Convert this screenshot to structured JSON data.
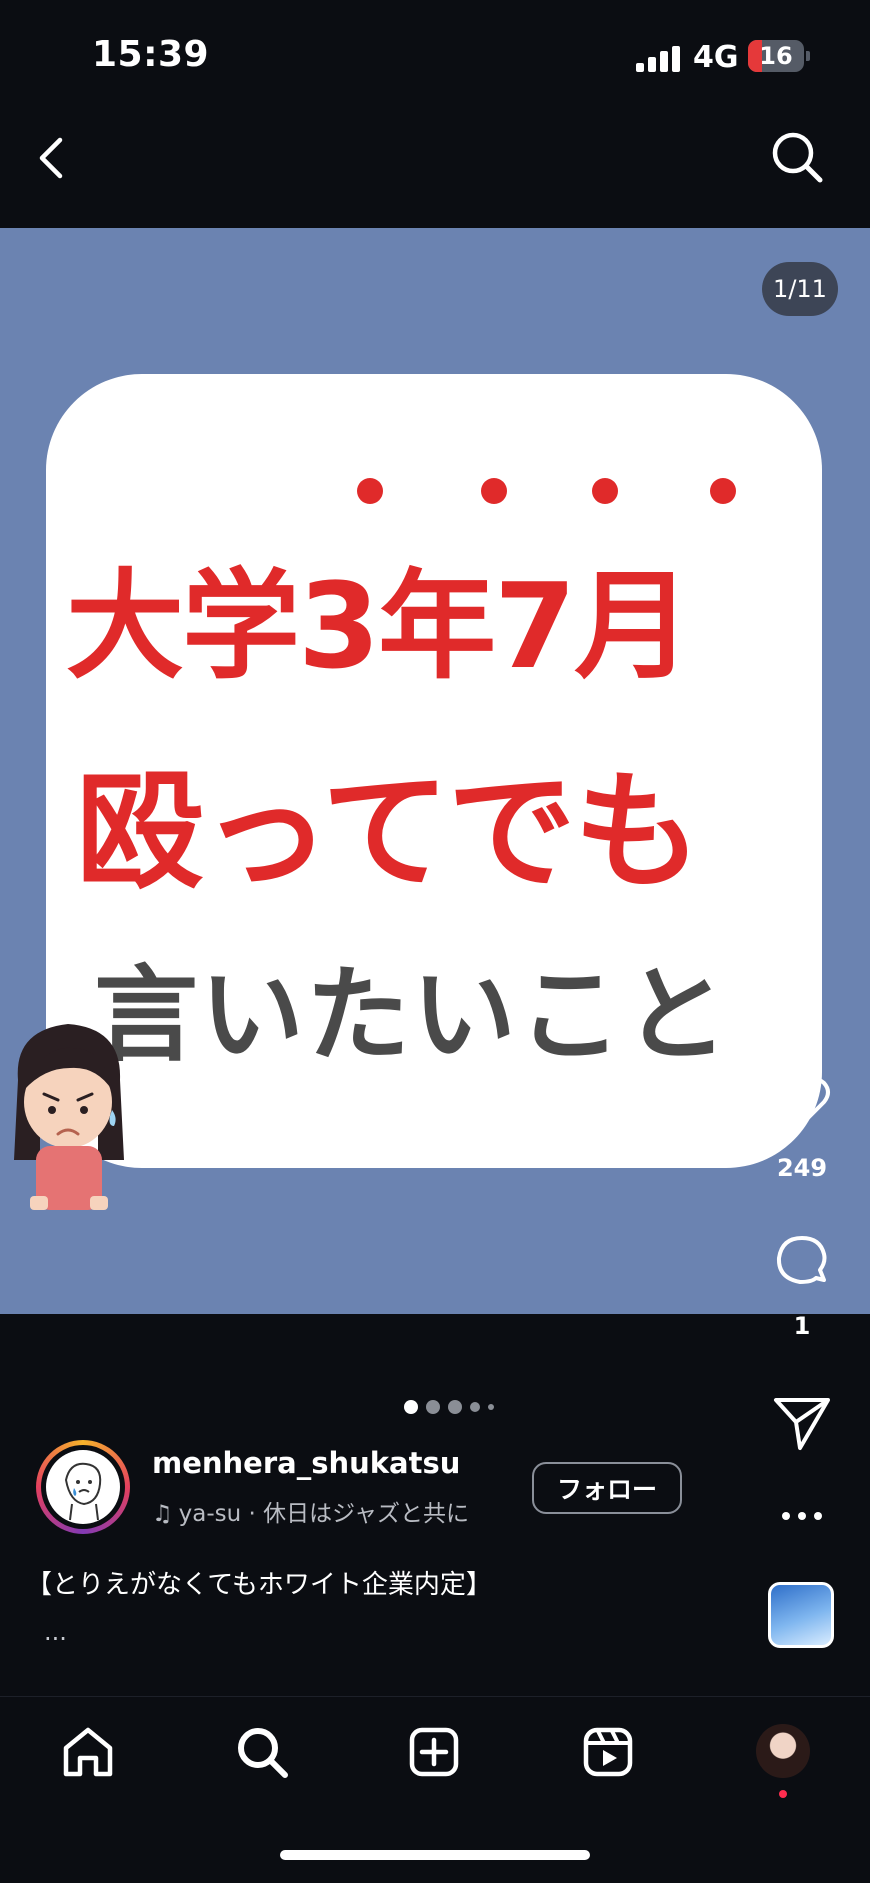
{
  "status_bar": {
    "time": "15:39",
    "network": "4G",
    "battery": "16"
  },
  "post": {
    "counter": "1/11",
    "slide_text": {
      "line1": "大学3年7月",
      "line2": "殴ってでも",
      "line3": "言いたいこと"
    },
    "like_count": "249",
    "comment_count": "1",
    "carousel": {
      "total_dots": 5,
      "active_index": 0
    }
  },
  "author": {
    "username": "menhera_shukatsu",
    "music": "ya-su · 休日はジャズと共に",
    "follow_label": "フォロー"
  },
  "caption": {
    "text": "【とりえがなくてもホワイト企業内定】",
    "more": "..."
  },
  "bottom_nav": {
    "items": [
      "home-icon",
      "search-icon",
      "create-icon",
      "reels-icon",
      "profile-avatar"
    ]
  },
  "colors": {
    "background": "#0b0d12",
    "post_background": "#6b83b1",
    "headline_red": "#e02a2a",
    "headline_gray": "#4a4a4a",
    "notification": "#ff2d4f"
  }
}
